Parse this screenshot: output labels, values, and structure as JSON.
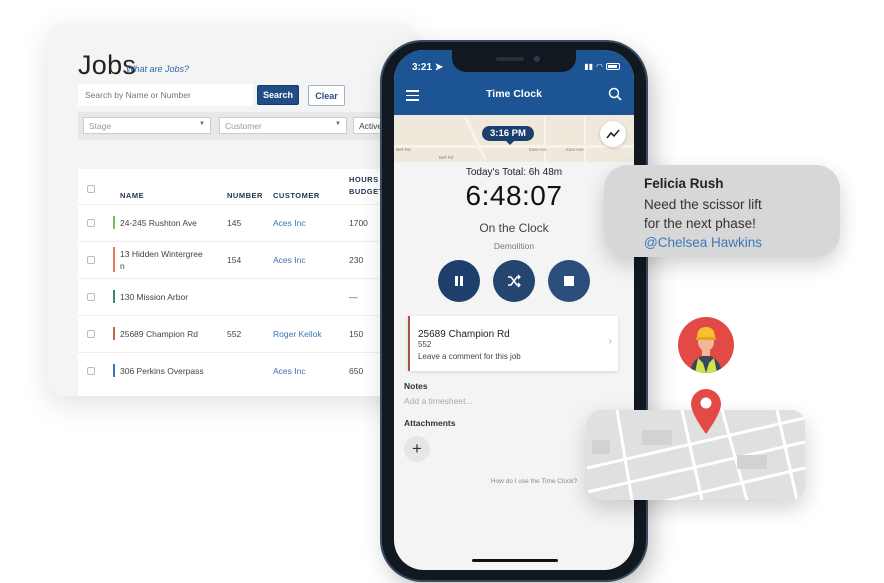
{
  "jobs": {
    "title": "Jobs",
    "help_link": "What are Jobs?",
    "search": {
      "placeholder": "Search by Name or Number",
      "search_label": "Search",
      "clear_label": "Clear"
    },
    "filters": [
      {
        "label": "Stage"
      },
      {
        "label": "Customer"
      },
      {
        "label": "Active"
      }
    ],
    "columns": {
      "name": "NAME",
      "number": "NUMBER",
      "customer": "CUSTOMER",
      "hours_line1": "HOURS",
      "hours_line2": "BUDGET"
    },
    "rows": [
      {
        "name": "24-245 Rushton Ave",
        "number": "145",
        "customer": "Aces Inc",
        "hours": "1700",
        "stripe": "#7dbb6a"
      },
      {
        "name_line1": "13 Hidden Wintergree",
        "name_line2": "n",
        "number": "154",
        "customer": "Aces Inc",
        "hours": "230",
        "stripe": "#e07b5a"
      },
      {
        "name": "130 Mission Arbor",
        "number": "",
        "customer": "",
        "hours": "—",
        "stripe": "#3d8a6a"
      },
      {
        "name": "25689 Champion Rd",
        "number": "552",
        "customer": "Roger Kellok",
        "hours": "150",
        "stripe": "#b7684b"
      },
      {
        "name": "306 Perkins Overpass",
        "number": "",
        "customer": "Aces Inc",
        "hours": "650",
        "stripe": "#3b74b5"
      }
    ]
  },
  "phone": {
    "status_time": "3:21",
    "app_title": "Time Clock",
    "map": {
      "time_pin": "3:16 PM",
      "labels": [
        "Bell Rd",
        "Bell Rd",
        "East Ave",
        "East Ave"
      ]
    },
    "todays_total": "Today's Total: 6h 48m",
    "clock": "6:48:07",
    "status": "On the Clock",
    "stage": "Demolition",
    "job": {
      "name": "25689 Champion Rd",
      "number": "552",
      "comment": "Leave a comment for this job"
    },
    "notes_label": "Notes",
    "notes_placeholder": "Add a timesheet...",
    "attachments_label": "Attachments",
    "add_symbol": "+",
    "help_link": "How do I use the Time Clock?"
  },
  "chat": {
    "sender": "Felicia Rush",
    "line1": "Need the scissor lift",
    "line2": "for the next phase!",
    "mention": "@Chelsea Hawkins"
  },
  "colors": {
    "brand_blue": "#1d5594",
    "button_navy": "#1e3f6c",
    "link_blue": "#3b74b5",
    "pin_red": "#e34a46"
  }
}
